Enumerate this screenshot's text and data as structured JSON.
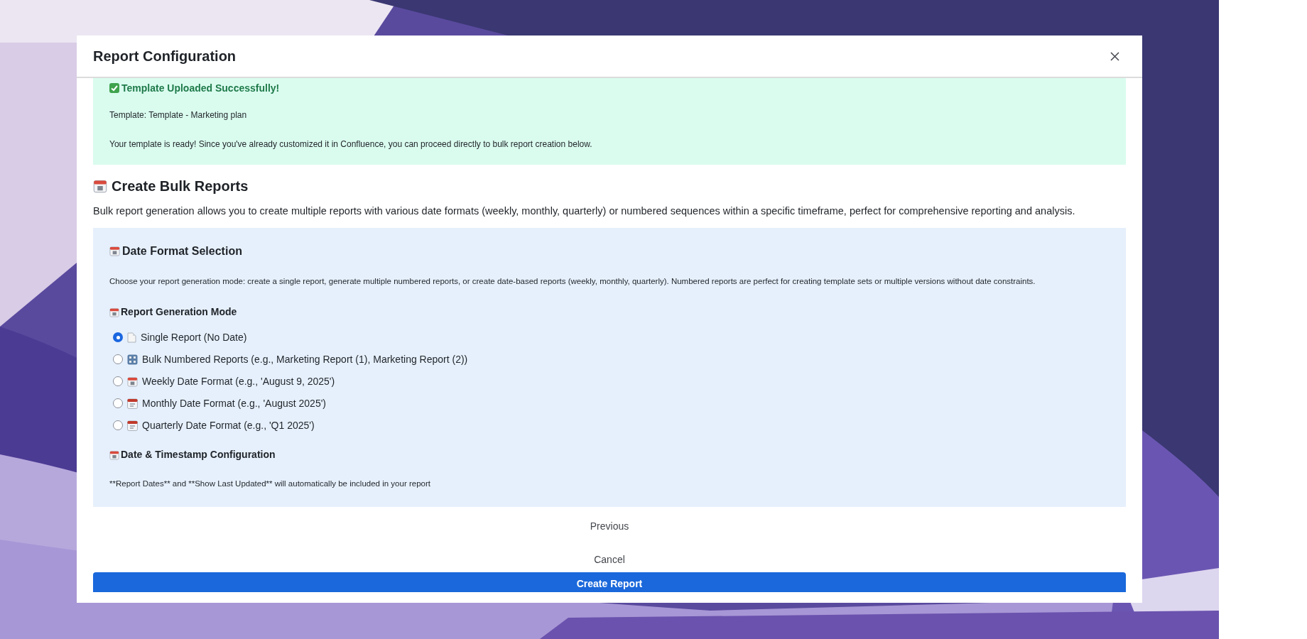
{
  "dialog": {
    "title": "Report Configuration",
    "success": {
      "title": "Template Uploaded Successfully!",
      "template": "Template: Template - Marketing plan",
      "message": "Your template is ready! Since you've already customized it in Confluence, you can proceed directly to bulk report creation below."
    },
    "section": {
      "title": "Create Bulk Reports",
      "description": "Bulk report generation allows you to create multiple reports with various date formats (weekly, monthly, quarterly) or numbered sequences within a specific timeframe, perfect for comprehensive reporting and analysis."
    },
    "date_format": {
      "title": "Date Format Selection",
      "description": "Choose your report generation mode: create a single report, generate multiple numbered reports, or create date-based reports (weekly, monthly, quarterly). Numbered reports are perfect for creating template sets or multiple versions without date constraints.",
      "mode_label": "Report Generation Mode",
      "options": [
        {
          "label": "Single Report (No Date)",
          "kind": "document",
          "selected": true
        },
        {
          "label": "Bulk Numbered Reports (e.g., Marketing Report (1), Marketing Report (2))",
          "kind": "numbers",
          "selected": false
        },
        {
          "label": "Weekly Date Format (e.g., 'August 9, 2025')",
          "kind": "calendar",
          "selected": false
        },
        {
          "label": "Monthly Date Format (e.g., 'August 2025')",
          "kind": "tear-calendar",
          "selected": false
        },
        {
          "label": "Quarterly Date Format (e.g., 'Q1 2025')",
          "kind": "tear-calendar",
          "selected": false
        }
      ],
      "timestamp_label": "Date & Timestamp Configuration",
      "timestamp_note": "**Report Dates** and **Show Last Updated** will automatically be included in your report"
    },
    "buttons": {
      "previous": "Previous",
      "cancel": "Cancel",
      "create": "Create Report"
    }
  }
}
